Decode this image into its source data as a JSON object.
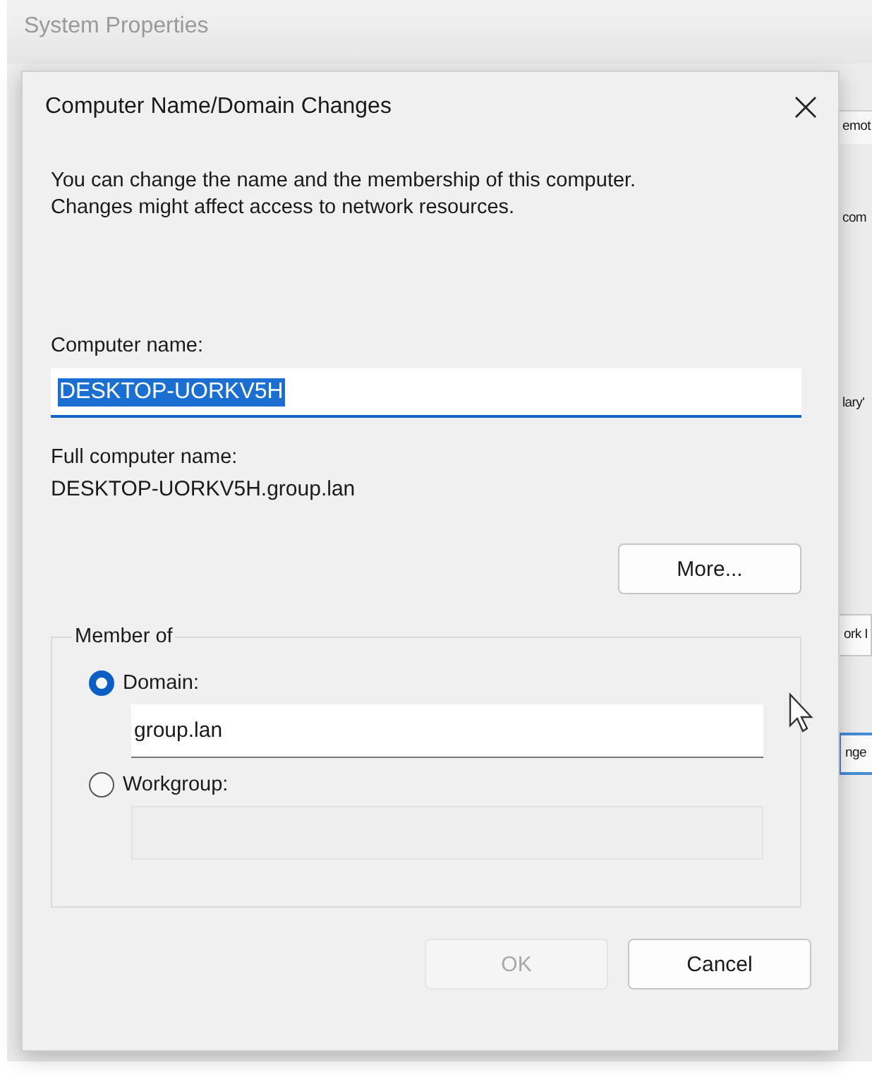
{
  "background_window": {
    "title": "System Properties",
    "fragments": [
      {
        "kind": "tab",
        "text": "emot"
      },
      {
        "kind": "text",
        "text": "com"
      },
      {
        "kind": "text",
        "text": "lary'"
      },
      {
        "kind": "button",
        "text": "ork I"
      },
      {
        "kind": "default_button",
        "text": "nge"
      }
    ]
  },
  "dialog": {
    "title": "Computer Name/Domain Changes",
    "description": "You can change the name and the membership of this computer. Changes might affect access to network resources.",
    "computer_name": {
      "label": "Computer name:",
      "value": "DESKTOP-UORKV5H",
      "selected": true
    },
    "full_name": {
      "label": "Full computer name:",
      "value": "DESKTOP-UORKV5H.group.lan"
    },
    "more_button": "More...",
    "member_of": {
      "legend": "Member of",
      "options": [
        {
          "label": "Domain:",
          "selected": true,
          "value": "group.lan",
          "disabled": false
        },
        {
          "label": "Workgroup:",
          "selected": false,
          "disabled": true
        }
      ]
    },
    "buttons": [
      {
        "label": "OK",
        "disabled": true
      },
      {
        "label": "Cancel",
        "disabled": false
      }
    ]
  }
}
